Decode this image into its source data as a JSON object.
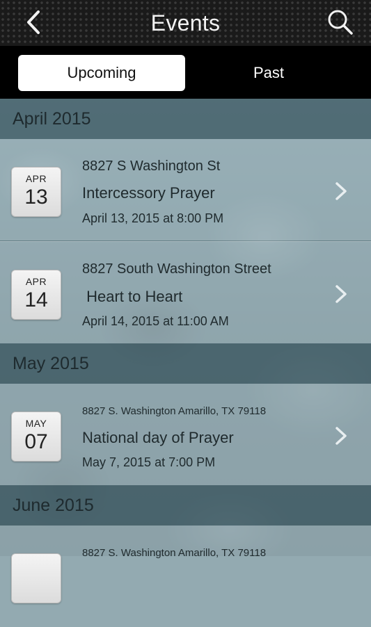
{
  "header": {
    "title": "Events",
    "back_icon": "chevron-left-icon",
    "search_icon": "search-icon"
  },
  "tabs": [
    {
      "label": "Upcoming",
      "active": true
    },
    {
      "label": "Past",
      "active": false
    }
  ],
  "sections": [
    {
      "title": "April 2015",
      "events": [
        {
          "month": "APR",
          "day": "13",
          "location": "8827 S Washington St",
          "title": "Intercessory Prayer",
          "time": "April 13, 2015 at 8:00 PM"
        },
        {
          "month": "APR",
          "day": "14",
          "location": "8827 South Washington Street",
          "title": " Heart to Heart",
          "time": "April 14, 2015 at 11:00 AM"
        }
      ]
    },
    {
      "title": "May 2015",
      "events": [
        {
          "month": "MAY",
          "day": "07",
          "location": "8827 S. Washington Amarillo, TX 79118",
          "title": "National day of Prayer",
          "time": "May 7, 2015 at 7:00 PM"
        }
      ]
    },
    {
      "title": "June 2015",
      "events": [
        {
          "month": "",
          "day": "",
          "location": "8827 S. Washington Amarillo, TX 79118",
          "title": "",
          "time": ""
        }
      ]
    }
  ],
  "colors": {
    "header_bg": "#1a1a1a",
    "tab_active_bg": "#ffffff",
    "row_bg": "#bed2d8",
    "section_bg": "#46626c"
  }
}
